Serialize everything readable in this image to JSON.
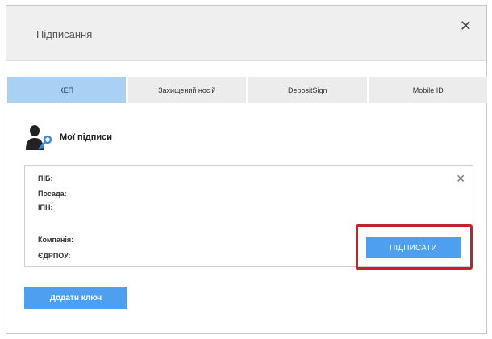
{
  "dialog": {
    "title": "Підписання",
    "close_glyph": "✕"
  },
  "tabs": [
    {
      "label": "КЕП",
      "active": true
    },
    {
      "label": "Захищений носій",
      "active": false
    },
    {
      "label": "DepositSign",
      "active": false
    },
    {
      "label": "Mobile ID",
      "active": false
    }
  ],
  "section": {
    "title": "Мої підписи",
    "icon": "user-key-icon"
  },
  "key_card": {
    "remove_glyph": "✕",
    "fields": {
      "pib": "ПІБ:",
      "position": "Посада:",
      "ipn": "ІПН:",
      "company": "Компанія:",
      "edrpou": "ЄДРПОУ:"
    },
    "sign_label": "ПІДПИСАТИ"
  },
  "add_key_label": "Додати ключ",
  "colors": {
    "accent": "#4f9ff0",
    "active_tab": "#a9d1f4",
    "highlight": "#c1232a",
    "header_bg": "#efefef"
  }
}
